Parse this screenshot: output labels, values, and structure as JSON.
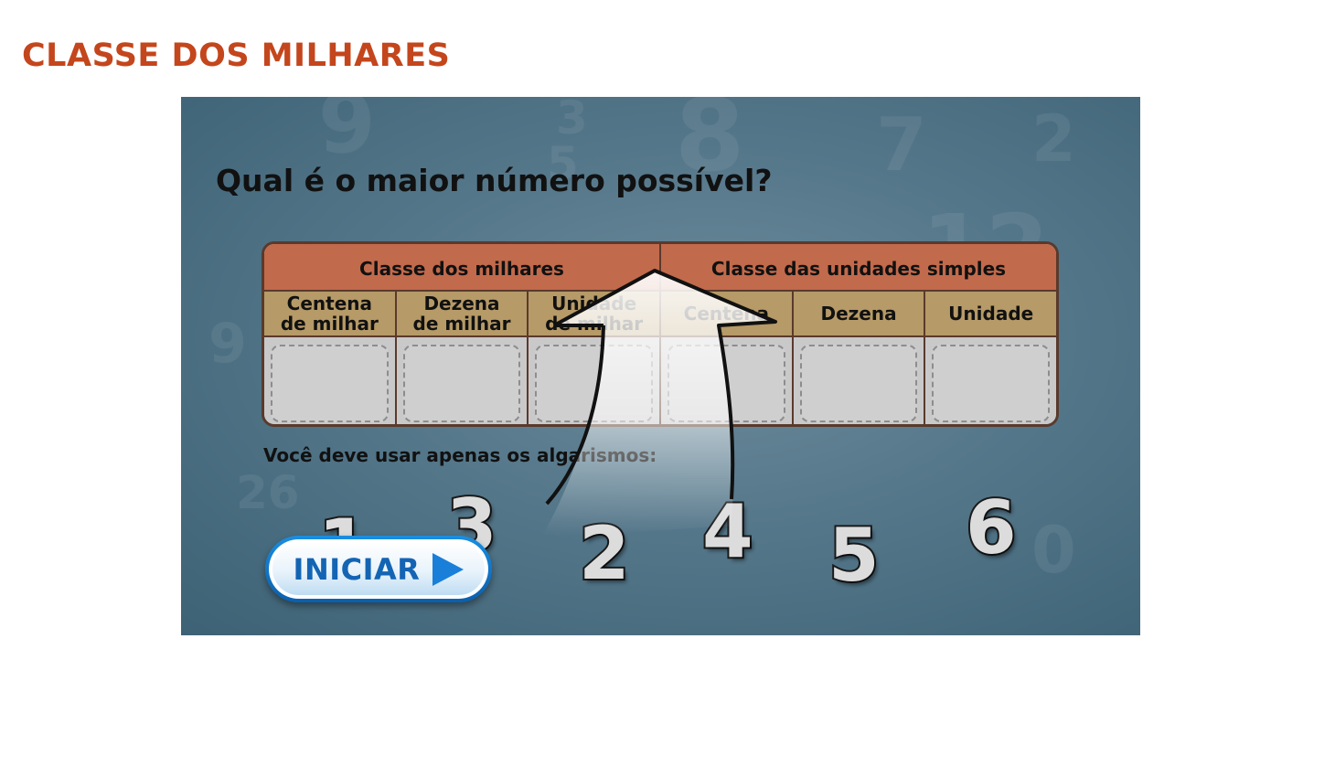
{
  "page": {
    "title": "CLASSE DOS MILHARES"
  },
  "game": {
    "question": "Qual é o maior número possível?",
    "classes": [
      {
        "label": "Classe dos milhares"
      },
      {
        "label": "Classe das unidades simples"
      }
    ],
    "orders": [
      {
        "label": "Centena\nde milhar"
      },
      {
        "label": "Dezena\nde milhar"
      },
      {
        "label": "Unidade\nde milhar"
      },
      {
        "label": "Centena"
      },
      {
        "label": "Dezena"
      },
      {
        "label": "Unidade"
      }
    ],
    "instruction": "Você deve usar apenas os algarismos:",
    "digits": [
      "1",
      "3",
      "2",
      "4",
      "5",
      "6"
    ],
    "start_button": {
      "label": "INICIAR"
    }
  },
  "colors": {
    "title": "#c4461c",
    "class_header": "#c26a4c",
    "order_header": "#b69a67",
    "button_text": "#1464b4"
  }
}
